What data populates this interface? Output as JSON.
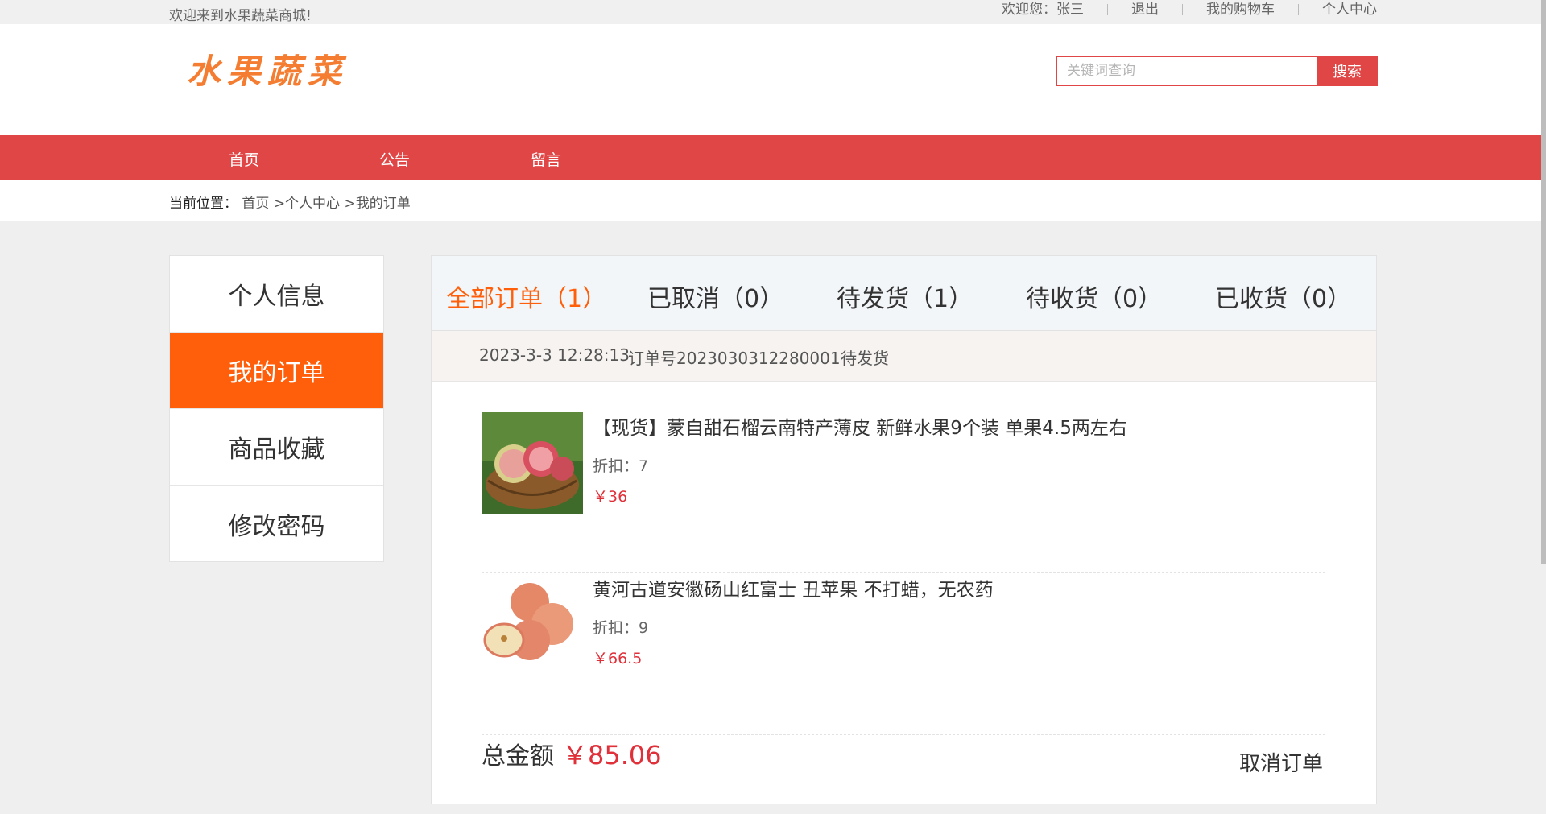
{
  "topbar": {
    "welcome": "欢迎来到水果蔬菜商城!",
    "user": "欢迎您：张三",
    "logout": "退出",
    "cart": "我的购物车",
    "center": "个人中心"
  },
  "header": {
    "logo": "水果蔬菜",
    "search_placeholder": "关键词查询",
    "search_button": "搜索"
  },
  "nav": [
    "首页",
    "公告",
    "留言"
  ],
  "breadcrumb": {
    "label": "当前位置：",
    "items": [
      "首页",
      ">个人中心",
      ">我的订单"
    ]
  },
  "sidebar": [
    "个人信息",
    "我的订单",
    "商品收藏",
    "修改密码"
  ],
  "tabs": [
    "全部订单（1）",
    "已取消（0）",
    "待发货（1）",
    "待收货（0）",
    "已收货（0）"
  ],
  "order": {
    "time": "2023-3-3 12:28:13",
    "number": "订单号202303031228000­1",
    "status": "待发货",
    "products": [
      {
        "title": "【现货】蒙自甜石榴云南特产薄皮 新鲜水果9个装 单果4.5两左右",
        "discount": "折扣：7",
        "price": "￥36"
      },
      {
        "title": "黄河古道安徽砀山红富士 丑苹果 不打蜡，无农药",
        "discount": "折扣：9",
        "price": "￥66.5"
      }
    ],
    "total_label": "总金额",
    "total_amount": "￥85.06",
    "cancel": "取消订单"
  },
  "colors": {
    "brand_red": "#e04646",
    "active_orange": "#ff5e0a",
    "price_red": "#e0303a"
  }
}
